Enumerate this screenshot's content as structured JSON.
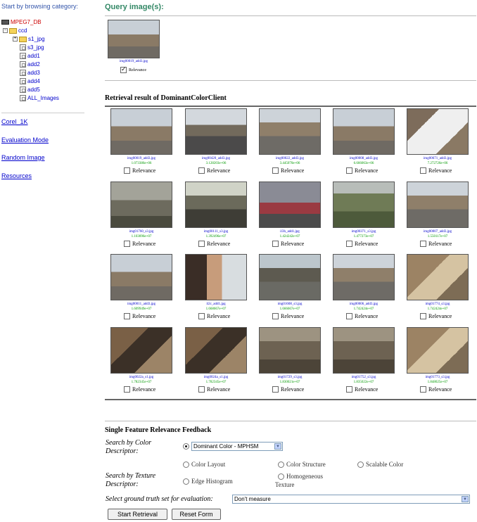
{
  "sidebar": {
    "heading": "Start by browsing category:",
    "tree": {
      "root": "MPEG7_DB",
      "folder": "ccd",
      "items": [
        "s1_jpg",
        "s3_jpg",
        "add1",
        "add2",
        "add3",
        "add4",
        "add5",
        "ALL_Images"
      ]
    },
    "links": [
      "Corel_1K",
      "Evaluation Mode",
      "Random Image",
      "Resources"
    ]
  },
  "query": {
    "title": "Query image(s):",
    "image": {
      "filename": "img00019_add3.jpg",
      "relevance_label": "Relevance",
      "relevance_checked": true,
      "scene": "palace"
    }
  },
  "results": {
    "title": "Retrieval result of DominantColorClient",
    "relevance_label": "Relevance",
    "items": [
      {
        "filename": "img00019_add3.jpg",
        "score": "1.073386e+06",
        "scene": "palace"
      },
      {
        "filename": "img00420_add3.jpg",
        "score": "3.128203e+06",
        "scene": "road"
      },
      {
        "filename": "img00022_add3.jpg",
        "score": "3.445070e+06",
        "scene": "parking"
      },
      {
        "filename": "img00008_add3.jpg",
        "score": "6.666063e+06",
        "scene": "palace"
      },
      {
        "filename": "img00671_add3.jpg",
        "score": "7.272726e+06",
        "scene": "snowman"
      },
      {
        "filename": "img01760_s3.jpg",
        "score": "1.103096e+07",
        "scene": "fence"
      },
      {
        "filename": "img00111_s3.jpg",
        "score": "1.392496e+07",
        "scene": "hills"
      },
      {
        "filename": "il3h_add1.jpg",
        "score": "1.424242e+07",
        "scene": "kids"
      },
      {
        "filename": "img00371_s3.jpg",
        "score": "1.477273e+07",
        "scene": "valley"
      },
      {
        "filename": "img00007_add3.jpg",
        "score": "1.550117e+07",
        "scene": "parking"
      },
      {
        "filename": "img00011_add3.jpg",
        "score": "1.609949e+07",
        "scene": "palace"
      },
      {
        "filename": "il2c_add1.jpg",
        "score": "1.668667e+07",
        "scene": "people"
      },
      {
        "filename": "img01608_s3.jpg",
        "score": "1.666667e+07",
        "scene": "building"
      },
      {
        "filename": "img00006_add3.jpg",
        "score": "1.742424e+07",
        "scene": "parking"
      },
      {
        "filename": "img01774_s3.jpg",
        "score": "1.742424e+07",
        "scene": "wall"
      },
      {
        "filename": "img0022a_s1.jpg",
        "score": "1.782345e+07",
        "scene": "rock"
      },
      {
        "filename": "img0024a_s1.jpg",
        "score": "1.782345e+07",
        "scene": "rock"
      },
      {
        "filename": "img01729_s3.jpg",
        "score": "1.830021e+07",
        "scene": "construction"
      },
      {
        "filename": "img01752_s3.jpg",
        "score": "1.835022e+07",
        "scene": "construction"
      },
      {
        "filename": "img01773_s3.jpg",
        "score": "1.848025e+07",
        "scene": "wall"
      }
    ]
  },
  "form": {
    "title": "Single Feature Relevance Feedback",
    "color_label_1": "Search by Color",
    "color_label_2": "Descriptor:",
    "color_select_value": "Dominant Color - MPHSM",
    "color_options": [
      "Color Layout",
      "Color Structure",
      "Scalable Color"
    ],
    "texture_label_1": "Search by Texture",
    "texture_label_2": "Descriptor:",
    "texture_options": [
      "Edge Histogram",
      "Homogeneous",
      "Texture"
    ],
    "ground_truth_label": "Select ground truth set for evaluation:",
    "ground_truth_value": "Don't measure",
    "start_button": "Start Retrieval",
    "reset_button": "Reset Form"
  },
  "colors": {
    "link": "#0000cc",
    "title_green": "#338866",
    "score_green": "#009900",
    "root_red": "#cc0000"
  }
}
